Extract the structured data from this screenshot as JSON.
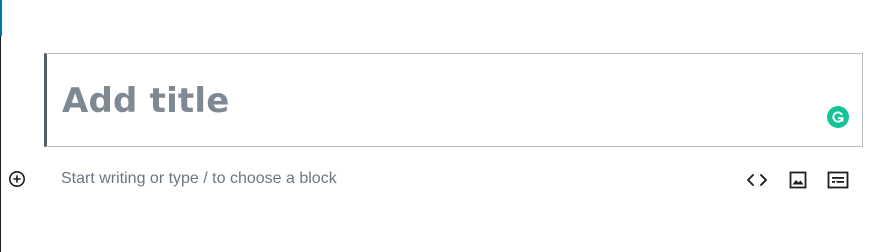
{
  "editor": {
    "title_placeholder": "Add title",
    "paragraph_placeholder": "Start writing or type / to choose a block",
    "grammarly_letter": "G"
  },
  "toolbar": {
    "icons": [
      "code-icon",
      "image-icon",
      "gallery-icon"
    ]
  },
  "colors": {
    "grammarly_green": "#15c39a",
    "title_text": "#7e8993",
    "wp_blue": "#0073aa"
  }
}
